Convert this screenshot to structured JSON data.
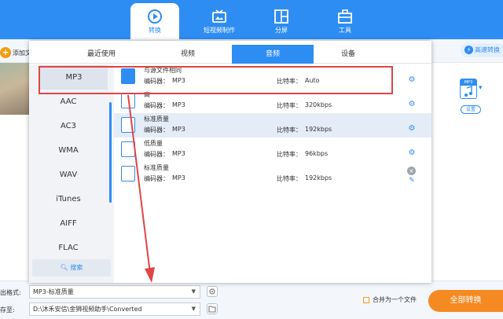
{
  "nav": {
    "items": [
      {
        "label": "转换",
        "icon": "convert-icon",
        "active": true
      },
      {
        "label": "短视频制作",
        "icon": "tv-icon",
        "active": false
      },
      {
        "label": "分屏",
        "icon": "split-screen-icon",
        "active": false
      },
      {
        "label": "工具",
        "icon": "toolbox-icon",
        "active": false
      }
    ]
  },
  "app": {
    "add_file_label": "添加文",
    "fast_convert_label": "高速转换",
    "format_badge": "MP3",
    "settings_label": "设置"
  },
  "popup": {
    "tabs": [
      {
        "label": "最近使用",
        "active": false
      },
      {
        "label": "视频",
        "active": false
      },
      {
        "label": "音频",
        "active": true
      },
      {
        "label": "设备",
        "active": false
      }
    ],
    "formats": [
      {
        "label": "MP3",
        "active": true
      },
      {
        "label": "AAC",
        "active": false
      },
      {
        "label": "AC3",
        "active": false
      },
      {
        "label": "WMA",
        "active": false
      },
      {
        "label": "WAV",
        "active": false
      },
      {
        "label": "iTunes",
        "active": false
      },
      {
        "label": "AIFF",
        "active": false
      },
      {
        "label": "FLAC",
        "active": false
      }
    ],
    "search_label": "搜索",
    "encoder_label": "编码器：",
    "bitrate_label": "比特率：",
    "presets": [
      {
        "name": "与源文件相同",
        "encoder": "MP3",
        "bitrate": "Auto",
        "highlight": false,
        "action": "gear"
      },
      {
        "name": "高",
        "encoder": "MP3",
        "bitrate": "320kbps",
        "highlight": false,
        "action": "gear"
      },
      {
        "name": "标准质量",
        "encoder": "MP3",
        "bitrate": "192kbps",
        "highlight": true,
        "action": "gear"
      },
      {
        "name": "低质量",
        "encoder": "MP3",
        "bitrate": "96kbps",
        "highlight": false,
        "action": "gear"
      },
      {
        "name": "标准质量",
        "encoder": "MP3",
        "bitrate": "192kbps",
        "highlight": false,
        "action": "delete-edit"
      }
    ]
  },
  "bottom": {
    "output_format_label": "出格式:",
    "output_format_value": "MP3-标准质量",
    "save_to_label": "存至:",
    "save_path": "D:\\沐禾安信\\金狮视频助手\\Converted",
    "merge_label": "合并为一个文件",
    "convert_all_label": "全部转换"
  },
  "colors": {
    "brand": "#2e8df3",
    "accent": "#f58a23",
    "annotation": "#e24444"
  }
}
